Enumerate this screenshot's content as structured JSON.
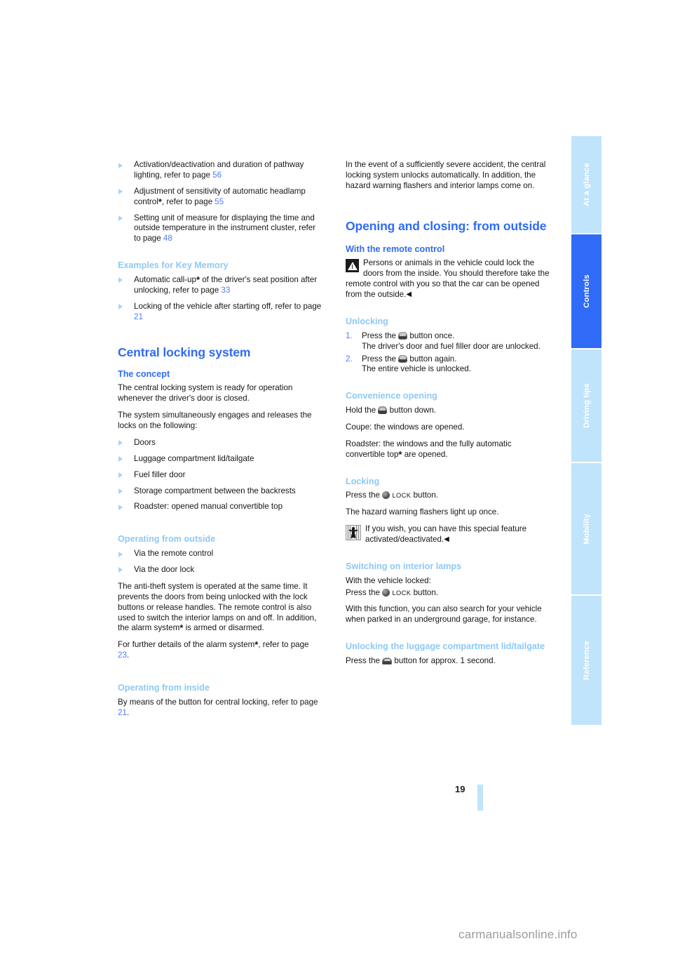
{
  "document": {
    "page_number": "19",
    "watermark": "carmanualsonline.info"
  },
  "sidebar": {
    "tabs": [
      {
        "label": "At a glance",
        "active": false
      },
      {
        "label": "Controls",
        "active": true
      },
      {
        "label": "Driving tips",
        "active": false
      },
      {
        "label": "Mobility",
        "active": false
      },
      {
        "label": "Reference",
        "active": false
      }
    ]
  },
  "left_column": {
    "intro_bullets": [
      "Activation/deactivation and duration of pathway lighting, refer to page ",
      "Adjustment of sensitivity of automatic headlamp control",
      "Setting unit of measure for displaying the time and outside temperature in the instrument cluster, refer to page "
    ],
    "intro_pages": [
      "56",
      "55",
      "48"
    ],
    "bullet2_mid": ", refer to page ",
    "key_memory": {
      "heading": "Examples for Key Memory",
      "b1_a": "Automatic call-up",
      "b1_b": " of the driver's seat position after unlocking, refer to page ",
      "b1_page": "33",
      "b2_a": "Locking of the vehicle after starting off, refer to page ",
      "b2_page": "21"
    },
    "central_locking": {
      "title": "Central locking system",
      "concept_heading": "The concept",
      "concept_p1": "The central locking system is ready for operation whenever the driver's door is closed.",
      "concept_p2": "The system simultaneously engages and releases the locks on the following:",
      "concept_items": [
        "Doors",
        "Luggage compartment lid/tailgate",
        "Fuel filler door",
        "Storage compartment between the backrests",
        "Roadster: opened manual convertible top"
      ]
    },
    "operating_outside": {
      "heading": "Operating from outside",
      "items": [
        "Via the remote control",
        "Via the door lock"
      ],
      "p1_a": "The anti-theft system is operated at the same time. It prevents the doors from being unlocked with the lock buttons or release handles. The remote control is also used to switch the interior lamps on and off. In addition, the alarm system",
      "p1_b": " is armed or disarmed.",
      "p2_a": "For further details of the alarm system",
      "p2_b": ", refer to page ",
      "p2_page": "23",
      "p2_c": "."
    },
    "operating_inside": {
      "heading": "Operating from inside",
      "p1_a": "By means of the button for central locking, refer to page ",
      "p1_page": "21",
      "p1_b": "."
    }
  },
  "right_column": {
    "accident_paragraph": "In the event of a sufficiently severe accident, the central locking system unlocks automatically. In addition, the hazard warning flashers and interior lamps come on.",
    "opening_closing": {
      "title": "Opening and closing: from outside",
      "remote_heading": "With the remote control",
      "warning_text": "Persons or animals in the vehicle could lock the doors from the inside. You should therefore take the remote control with you so that the car can be opened from the outside.",
      "warning_end": "◀"
    },
    "unlocking": {
      "heading": "Unlocking",
      "step1_num": "1.",
      "step1_a": "Press the ",
      "step1_b": " button once.",
      "step1_sub": "The driver's door and fuel filler door are unlocked.",
      "step2_num": "2.",
      "step2_a": "Press the ",
      "step2_b": " button again.",
      "step2_sub": "The entire vehicle is unlocked."
    },
    "convenience": {
      "heading": "Convenience opening",
      "p1_a": "Hold the ",
      "p1_b": " button down.",
      "p2": "Coupe: the windows are opened.",
      "p3_a": "Roadster: the windows and the fully automatic convertible top",
      "p3_b": " are opened."
    },
    "locking": {
      "heading": "Locking",
      "p1_a": "Press the ",
      "p1_lock": "Lock",
      "p1_b": " button.",
      "p2": "The hazard warning flashers light up once.",
      "note": "If you wish, you can have this special feature activated/deactivated.",
      "note_end": "◀"
    },
    "interior_lamps": {
      "heading": "Switching on interior lamps",
      "p1": "With the vehicle locked:",
      "p2_a": "Press the ",
      "p2_lock": "Lock",
      "p2_b": " button.",
      "p3": "With this function, you can also search for your vehicle when parked in an underground garage, for instance."
    },
    "luggage": {
      "heading": "Unlocking the luggage compartment lid/tailgate",
      "p1_a": "Press the ",
      "p1_b": " button for approx. 1 second."
    }
  },
  "symbols": {
    "asterisk": "*",
    "car_unlock_icon": "car-unlock-icon",
    "lock_button_icon": "lock-button-icon",
    "trunk_button_icon": "trunk-button-icon",
    "warning_icon": "warning-triangle-icon",
    "service_icon": "service-dealer-icon"
  }
}
